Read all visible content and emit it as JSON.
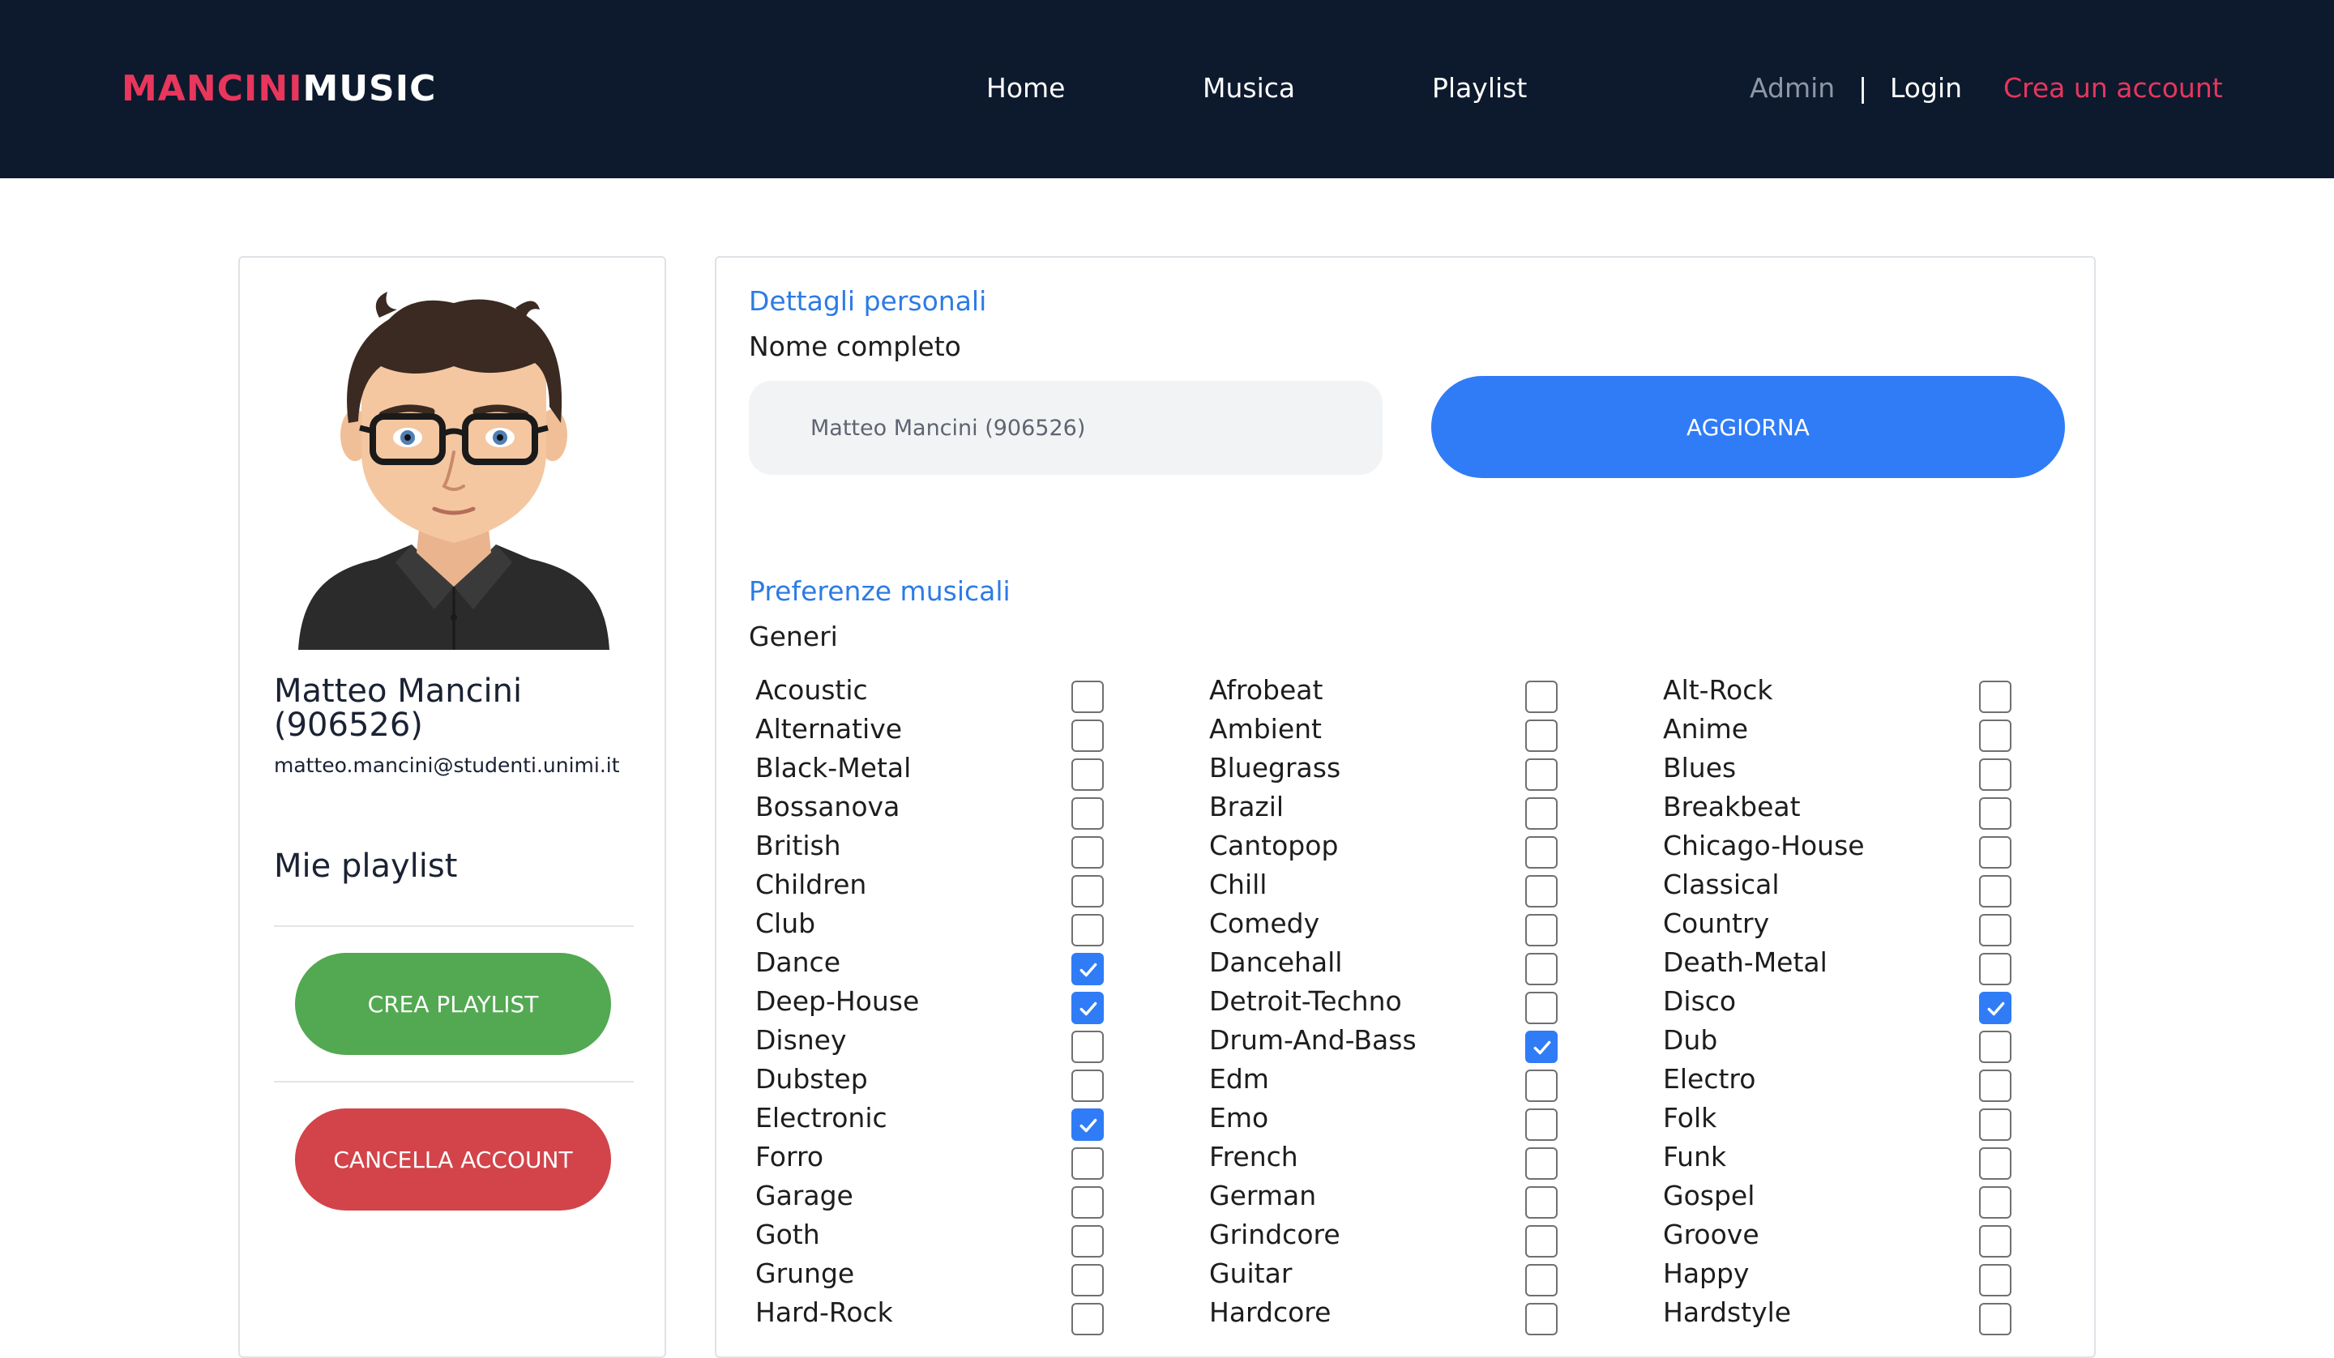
{
  "nav": {
    "brand_part1": "MANCINI",
    "brand_part2": "MUSIC",
    "links": [
      "Home",
      "Musica",
      "Playlist"
    ],
    "admin": "Admin",
    "separator": "|",
    "login": "Login",
    "signup": "Crea un account"
  },
  "profile": {
    "name": "Matteo Mancini (906526)",
    "email": "matteo.mancini@studenti.unimi.it",
    "playlists_title": "Mie playlist",
    "create_playlist": "CREA PLAYLIST",
    "delete_account": "CANCELLA ACCOUNT"
  },
  "details": {
    "personal_title": "Dettagli personali",
    "full_name_label": "Nome completo",
    "full_name_value": "Matteo Mancini (906526)",
    "update_button": "AGGIORNA",
    "music_title": "Preferenze musicali",
    "genres_label": "Generi"
  },
  "genres": {
    "columns": [
      [
        {
          "label": "Acoustic",
          "checked": false
        },
        {
          "label": "Alternative",
          "checked": false
        },
        {
          "label": "Black-Metal",
          "checked": false
        },
        {
          "label": "Bossanova",
          "checked": false
        },
        {
          "label": "British",
          "checked": false
        },
        {
          "label": "Children",
          "checked": false
        },
        {
          "label": "Club",
          "checked": false
        },
        {
          "label": "Dance",
          "checked": true
        },
        {
          "label": "Deep-House",
          "checked": true
        },
        {
          "label": "Disney",
          "checked": false
        },
        {
          "label": "Dubstep",
          "checked": false
        },
        {
          "label": "Electronic",
          "checked": true
        },
        {
          "label": "Forro",
          "checked": false
        },
        {
          "label": "Garage",
          "checked": false
        },
        {
          "label": "Goth",
          "checked": false
        },
        {
          "label": "Grunge",
          "checked": false
        },
        {
          "label": "Hard-Rock",
          "checked": false
        }
      ],
      [
        {
          "label": "Afrobeat",
          "checked": false
        },
        {
          "label": "Ambient",
          "checked": false
        },
        {
          "label": "Bluegrass",
          "checked": false
        },
        {
          "label": "Brazil",
          "checked": false
        },
        {
          "label": "Cantopop",
          "checked": false
        },
        {
          "label": "Chill",
          "checked": false
        },
        {
          "label": "Comedy",
          "checked": false
        },
        {
          "label": "Dancehall",
          "checked": false
        },
        {
          "label": "Detroit-Techno",
          "checked": false
        },
        {
          "label": "Drum-And-Bass",
          "checked": true
        },
        {
          "label": "Edm",
          "checked": false
        },
        {
          "label": "Emo",
          "checked": false
        },
        {
          "label": "French",
          "checked": false
        },
        {
          "label": "German",
          "checked": false
        },
        {
          "label": "Grindcore",
          "checked": false
        },
        {
          "label": "Guitar",
          "checked": false
        },
        {
          "label": "Hardcore",
          "checked": false
        }
      ],
      [
        {
          "label": "Alt-Rock",
          "checked": false
        },
        {
          "label": "Anime",
          "checked": false
        },
        {
          "label": "Blues",
          "checked": false
        },
        {
          "label": "Breakbeat",
          "checked": false
        },
        {
          "label": "Chicago-House",
          "checked": false
        },
        {
          "label": "Classical",
          "checked": false
        },
        {
          "label": "Country",
          "checked": false
        },
        {
          "label": "Death-Metal",
          "checked": false
        },
        {
          "label": "Disco",
          "checked": true
        },
        {
          "label": "Dub",
          "checked": false
        },
        {
          "label": "Electro",
          "checked": false
        },
        {
          "label": "Folk",
          "checked": false
        },
        {
          "label": "Funk",
          "checked": false
        },
        {
          "label": "Gospel",
          "checked": false
        },
        {
          "label": "Groove",
          "checked": false
        },
        {
          "label": "Happy",
          "checked": false
        },
        {
          "label": "Hardstyle",
          "checked": false
        }
      ]
    ]
  },
  "colors": {
    "navbar_bg": "#0d1a2d",
    "brand_accent": "#e8365d",
    "link_blue": "#2c7be5",
    "primary_button": "#2f7cf6",
    "success_button": "#53a852",
    "danger_button": "#d2444a"
  },
  "icons": {
    "avatar": "cartoon-avatar-with-glasses",
    "checkbox_checked": "check-icon"
  }
}
